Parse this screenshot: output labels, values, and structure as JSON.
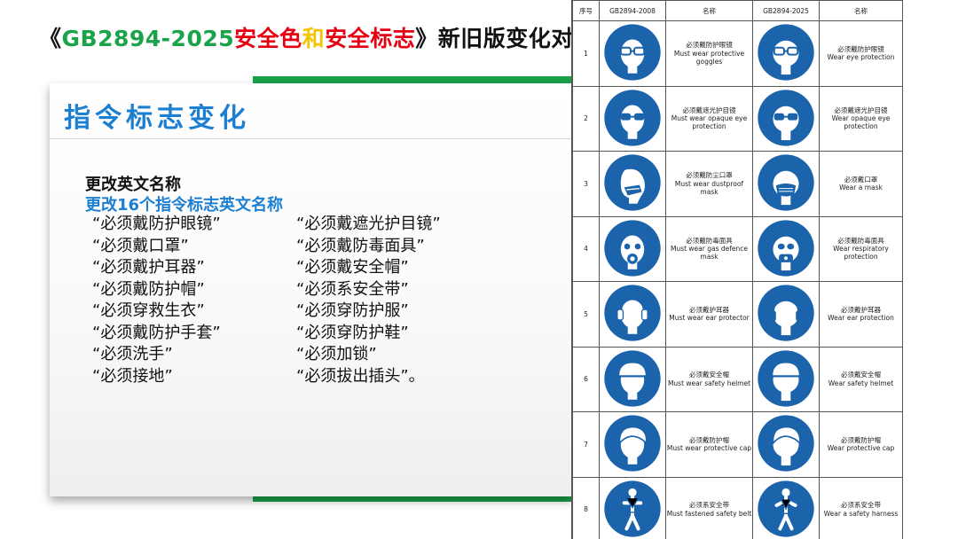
{
  "title": {
    "open": "《",
    "gb": "GB2894-2025",
    "safety": "安全",
    "color": "色",
    "and": "和",
    "sign": "安全标志",
    "rest": "》新旧版变化对"
  },
  "card": {
    "heading": "指令标志变化",
    "subheading_1": "更改英文名称",
    "subheading_2": "更改16个指令标志英文名称",
    "signs": [
      "“必须戴防护眼镜”",
      "“必须戴遮光护目镜”",
      "“必须戴口罩”",
      "“必须戴防毒面具”",
      "“必须戴护耳器”",
      "“必须戴安全帽”",
      "“必须戴防护帽”",
      "“必须系安全带”",
      "“必须穿救生衣”",
      "“必须穿防护服”",
      "“必须戴防护手套”",
      "“必须穿防护鞋”",
      "“必须洗手”",
      "“必须加锁”",
      "“必须接地”",
      "“必须拔出插头”。"
    ]
  },
  "table": {
    "headers": [
      "序号",
      "GB2894-2008",
      "名称",
      "GB2894-2025",
      "名称"
    ],
    "rows": [
      {
        "no": "1",
        "icon_old": "goggles-icon",
        "old_cn": "必须戴防护眼镜",
        "old_en": "Must wear protective goggles",
        "icon_new": "goggles-icon",
        "new_cn": "必须戴防护眼镜",
        "new_en": "Wear eye protection"
      },
      {
        "no": "2",
        "icon_old": "opaque-goggles-icon",
        "old_cn": "必须戴遮光护目镜",
        "old_en": "Must wear opaque eye protection",
        "icon_new": "opaque-goggles-icon",
        "new_cn": "必须戴遮光护目镜",
        "new_en": "Wear opaque eye protection"
      },
      {
        "no": "3",
        "icon_old": "dust-mask-icon",
        "old_cn": "必须戴防尘口罩",
        "old_en": "Must wear dustproof mask",
        "icon_new": "mask-icon",
        "new_cn": "必须戴口罩",
        "new_en": "Wear a mask"
      },
      {
        "no": "4",
        "icon_old": "gas-mask-icon",
        "old_cn": "必须戴防毒面具",
        "old_en": "Must wear gas defence mask",
        "icon_new": "respirator-icon",
        "new_cn": "必须戴防毒面具",
        "new_en": "Wear respiratory protection"
      },
      {
        "no": "5",
        "icon_old": "ear-protector-icon",
        "old_cn": "必须戴护耳器",
        "old_en": "Must wear ear protector",
        "icon_new": "ear-protection-icon",
        "new_cn": "必须戴护耳器",
        "new_en": "Wear ear protection"
      },
      {
        "no": "6",
        "icon_old": "safety-helmet-icon",
        "old_cn": "必须戴安全帽",
        "old_en": "Must wear safety helmet",
        "icon_new": "safety-helmet-icon",
        "new_cn": "必须戴安全帽",
        "new_en": "Wear safety helmet"
      },
      {
        "no": "7",
        "icon_old": "protective-cap-icon",
        "old_cn": "必须戴防护帽",
        "old_en": "Must wear protective cap",
        "icon_new": "protective-cap-icon",
        "new_cn": "必须戴防护帽",
        "new_en": "Wear protective cap"
      },
      {
        "no": "8",
        "icon_old": "safety-belt-icon",
        "old_cn": "必须系安全带",
        "old_en": "Must fastened safety  belt",
        "icon_new": "safety-harness-icon",
        "new_cn": "必须系安全带",
        "new_en": "Wear a safety harness"
      }
    ]
  },
  "colors": {
    "accent_blue": "#1d7fd1",
    "sign_blue": "#1b64ac",
    "green": "#1aa34a",
    "red": "#e60012",
    "yellow": "#f5c400"
  }
}
